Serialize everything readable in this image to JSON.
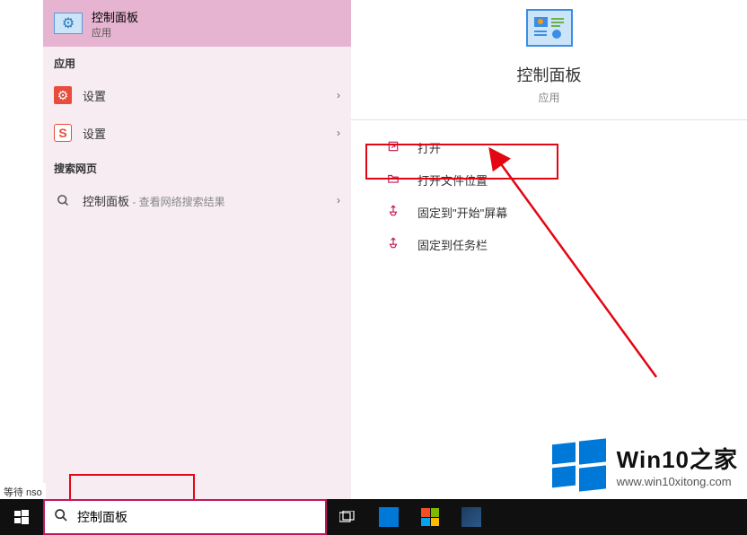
{
  "topResult": {
    "title": "控制面板",
    "subtitle": "应用"
  },
  "sections": {
    "apps": "应用",
    "web": "搜索网页"
  },
  "leftItems": {
    "settings1": "设置",
    "settings2": "设置",
    "webSearch": "控制面板",
    "webSearchSub": " - 查看网络搜索结果"
  },
  "preview": {
    "title": "控制面板",
    "subtitle": "应用"
  },
  "actions": {
    "open": "打开",
    "openLocation": "打开文件位置",
    "pinStart": "固定到\"开始\"屏幕",
    "pinTaskbar": "固定到任务栏"
  },
  "search": {
    "value": "控制面板"
  },
  "statusHint": "等待 nso",
  "watermark": {
    "title": "Win10之家",
    "url": "www.win10xitong.com"
  },
  "icons": {
    "gear": "⚙",
    "search": "🔍",
    "chevron": "›",
    "openArrow": "↗",
    "folder": "📁",
    "pin": "📌",
    "taskview": "⊞",
    "s": "S"
  }
}
